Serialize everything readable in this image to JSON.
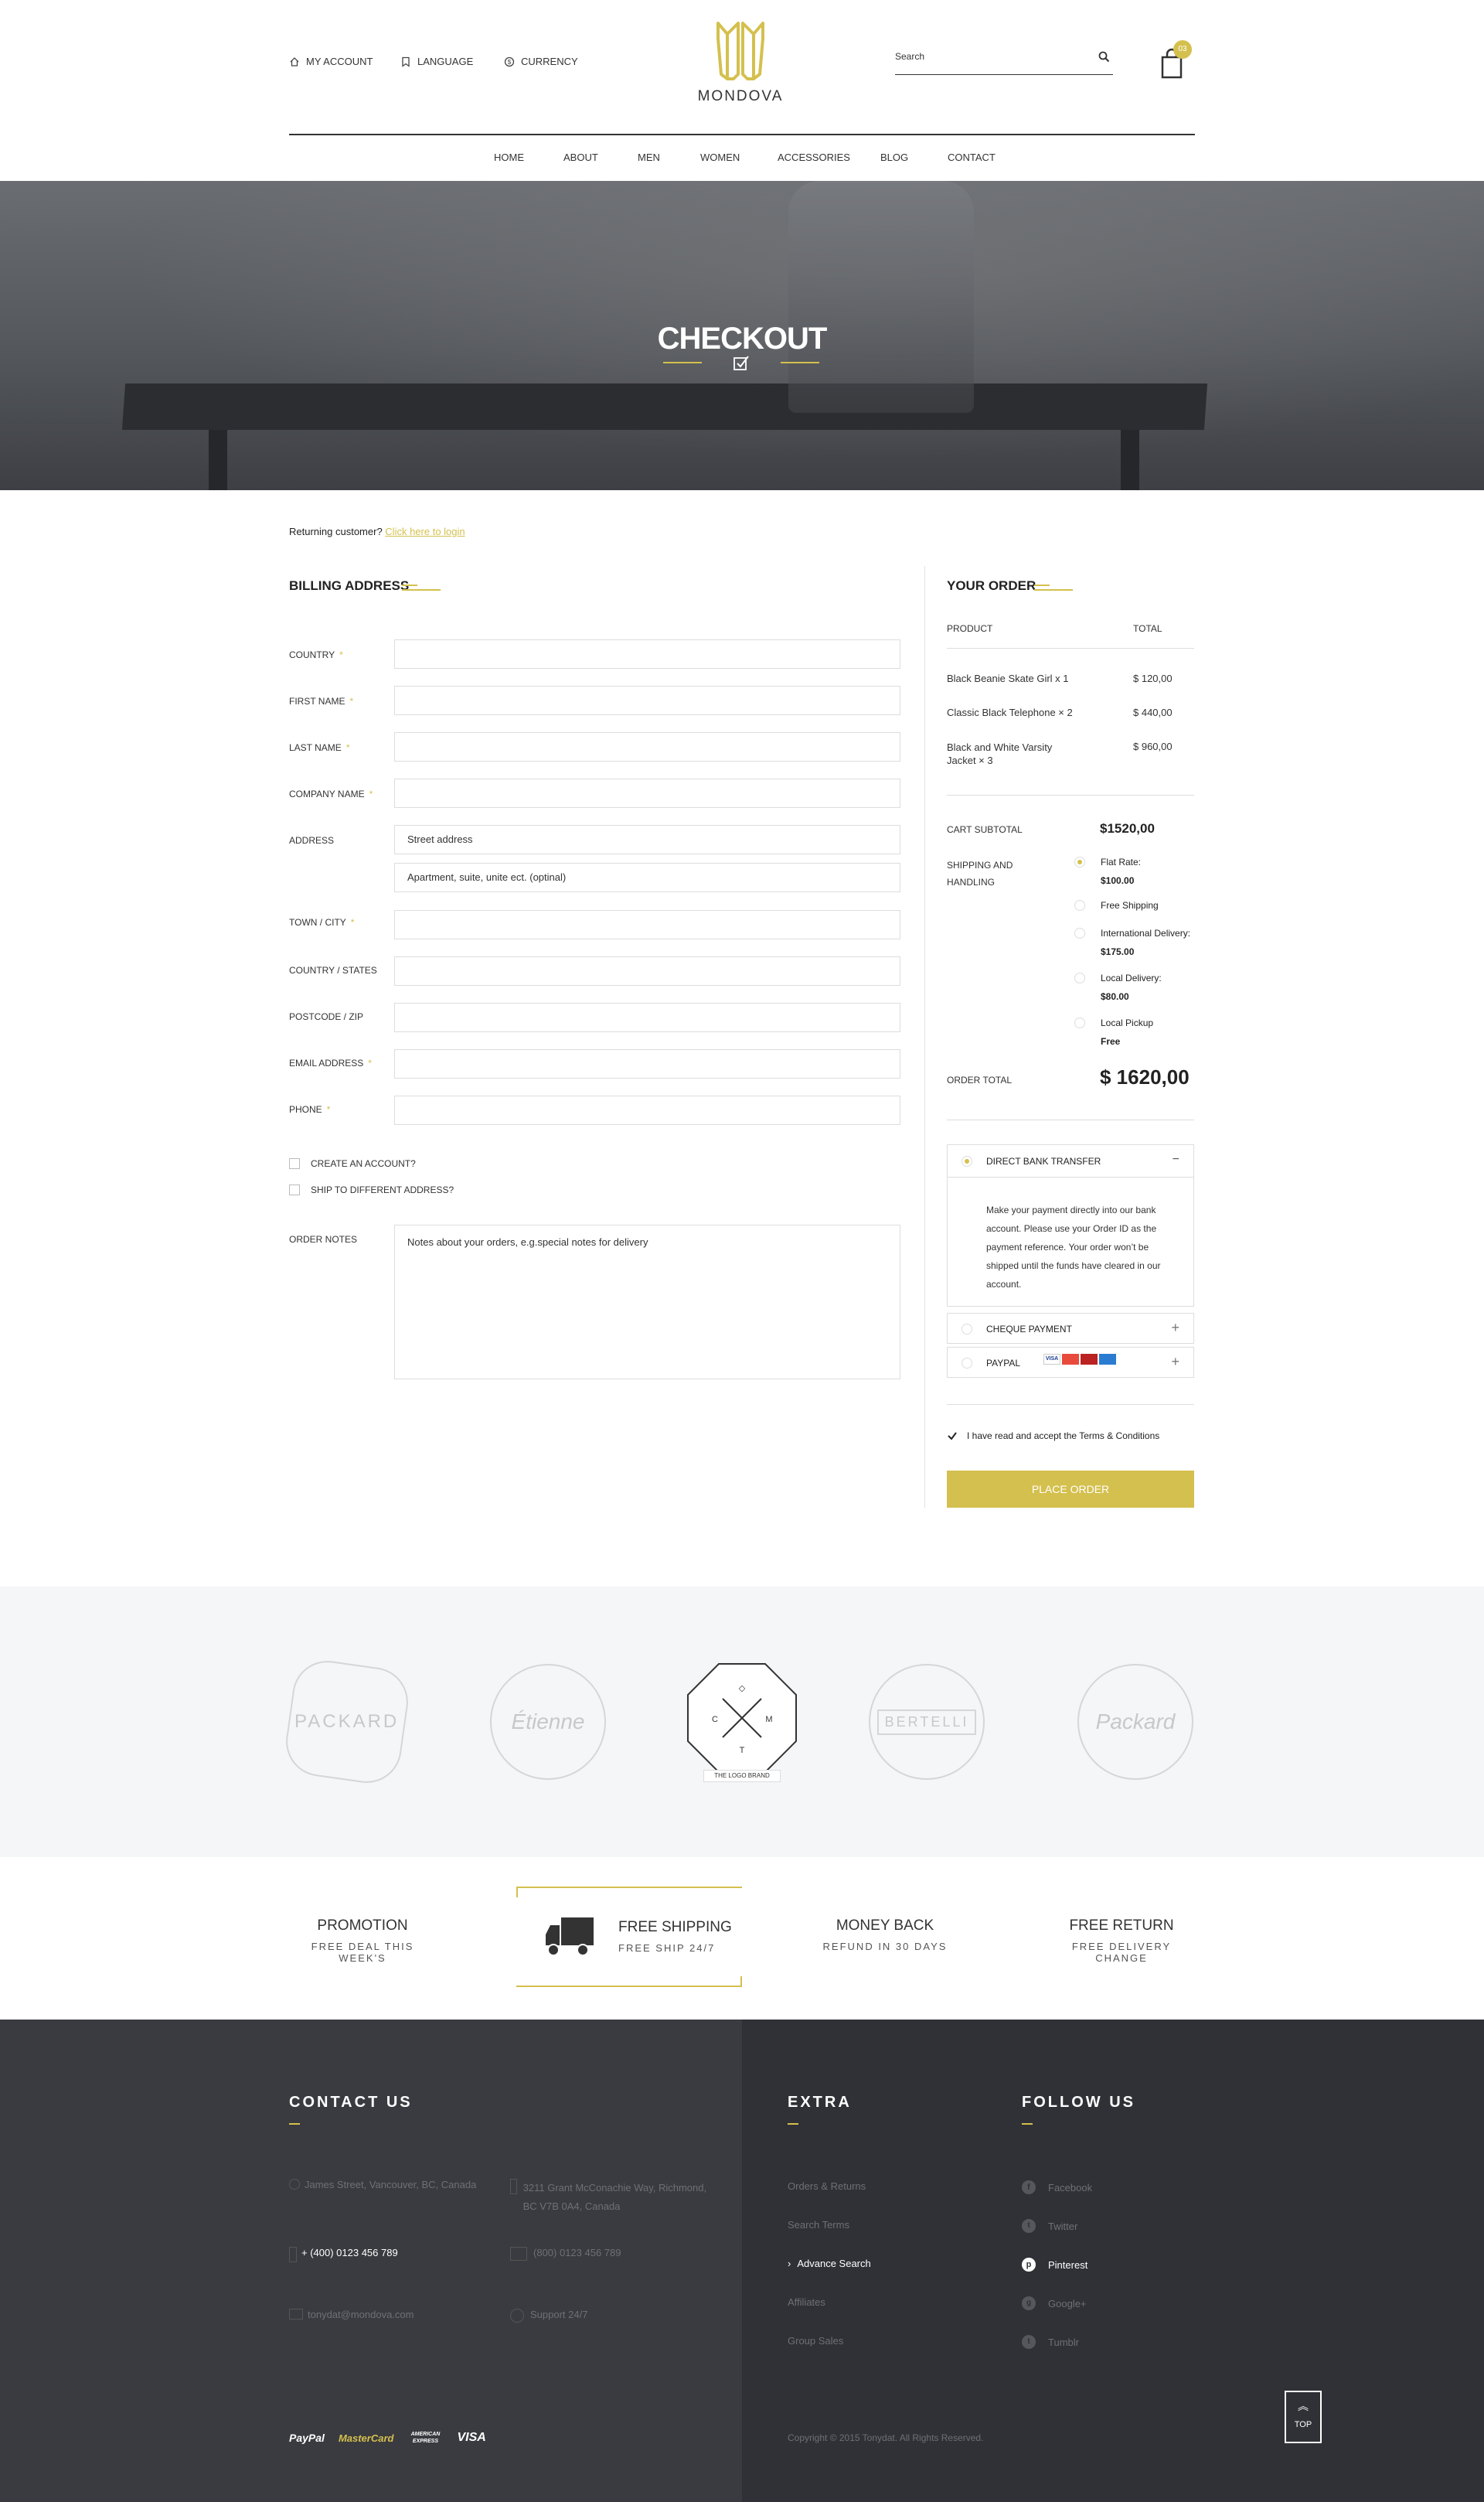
{
  "header": {
    "my_account": "MY ACCOUNT",
    "language": "LANGUAGE",
    "currency": "CURRENCY",
    "logo_text": "MONDOVA",
    "search_placeholder": "Search",
    "cart_count": "03"
  },
  "nav": [
    "HOME",
    "ABOUT",
    "MEN",
    "WOMEN",
    "ACCESSORIES",
    "BLOG",
    "CONTACT"
  ],
  "hero": {
    "title": "CHECKOUT"
  },
  "returning": {
    "text": "Returning customer?",
    "link": "Click here to login"
  },
  "billing": {
    "title": "BILLING ADDRESS",
    "fields": {
      "country": "COUNTRY",
      "first_name": "FIRST NAME",
      "last_name": "LAST NAME",
      "company": "COMPANY NAME",
      "address": "ADDRESS",
      "address_1_placeholder": "Street address",
      "address_2_placeholder": "Apartment, suite, unite ect. (optinal)",
      "town": "TOWN / CITY",
      "states": "COUNTRY / STATES",
      "postcode": "POSTCODE / ZIP",
      "email": "EMAIL ADDRESS",
      "phone": "PHONE"
    },
    "create_account": "CREATE AN ACCOUNT?",
    "ship_different": "SHIP TO DIFFERENT ADDRESS?",
    "order_notes": "ORDER NOTES",
    "notes_placeholder": "Notes about your orders, e.g.special notes for delivery"
  },
  "order": {
    "title": "YOUR ORDER",
    "col_product": "PRODUCT",
    "col_total": "TOTAL",
    "items": [
      {
        "name": "Black Beanie Skate Girl x 1",
        "total": "$ 120,00"
      },
      {
        "name": "Classic Black Telephone × 2",
        "total": "$ 440,00"
      },
      {
        "name": "Black and White Varsity Jacket × 3",
        "total": "$ 960,00"
      }
    ],
    "cart_subtotal_label": "CART SUBTOTAL",
    "cart_subtotal": "$1520,00",
    "shipping_label": "SHIPPING AND HANDLING",
    "shipping_options": [
      {
        "name": "Flat Rate:",
        "price": "$100.00",
        "selected": true
      },
      {
        "name": "Free Shipping",
        "price": "",
        "selected": false
      },
      {
        "name": "International Delivery:",
        "price": "$175.00",
        "selected": false
      },
      {
        "name": "Local Delivery:",
        "price": "$80.00",
        "selected": false
      },
      {
        "name": "Local Pickup",
        "price": "Free",
        "selected": false
      }
    ],
    "order_total_label": "ORDER TOTAL",
    "order_total": "$ 1620,00",
    "payment": {
      "bank": "DIRECT BANK TRANSFER",
      "bank_desc": "Make your payment directly into our bank account. Please use your Order ID as the payment reference. Your order won’t be shipped until the funds have cleared in our account.",
      "cheque": "CHEQUE PAYMENT",
      "paypal": "PAYPAL"
    },
    "terms": "I have read and accept the Terms & Conditions",
    "place_order": "PLACE ORDER"
  },
  "brands": {
    "logo_brand_label": "THE LOGO BRAND"
  },
  "features": [
    {
      "title": "PROMOTION",
      "sub": "FREE DEAL THIS WEEK'S"
    },
    {
      "title": "FREE SHIPPING",
      "sub": "FREE SHIP 24/7"
    },
    {
      "title": "MONEY BACK",
      "sub": "REFUND IN 30 DAYS"
    },
    {
      "title": "FREE RETURN",
      "sub": "FREE DELIVERY CHANGE"
    }
  ],
  "footer": {
    "contact_title": "CONTACT US",
    "address1": "James Street, Vancouver, BC, Canada",
    "address2": "3211 Grant McConachie Way, Richmond, BC V7B 0A4, Canada",
    "phone1": "+ (400) 0123 456 789",
    "phone2": "(800) 0123 456 789",
    "email": "tonydat@mondova.com",
    "support": "Support 24/7",
    "extra_title": "EXTRA",
    "extra_links": [
      "Orders & Returns",
      "Search Terms",
      "Advance Search",
      "Affiliates",
      "Group Sales"
    ],
    "follow_title": "FOLLOW US",
    "follow_links": [
      "Facebook",
      "Twitter",
      "Pinterest",
      "Google+",
      "Tumblr"
    ],
    "copyright": "Copyright © 2015 Tonydat. All Rights Reserved.",
    "top_label": "TOP",
    "pay_logos": [
      "PayPal",
      "MasterCard",
      "AMERICAN EXPRESS",
      "VISA"
    ]
  },
  "colors": {
    "accent": "#d4c04e",
    "dark": "#3a3b40",
    "darker": "#303136"
  }
}
